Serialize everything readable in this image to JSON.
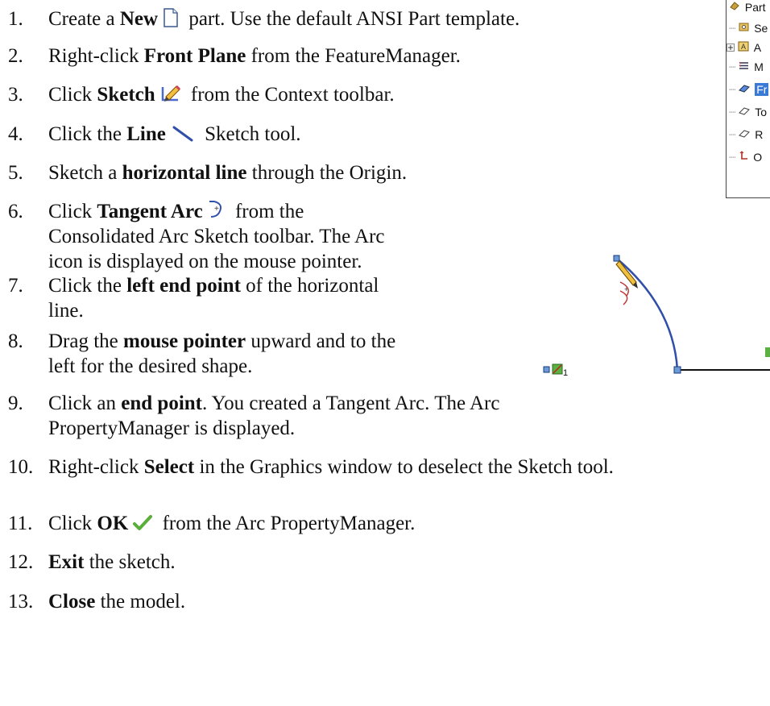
{
  "steps": [
    {
      "num": "1.",
      "segments": [
        {
          "t": "Create a "
        },
        {
          "t": "New",
          "b": true
        },
        {
          "icon": "new-document-icon"
        },
        {
          "t": " part. Use the default ANSI Part template."
        }
      ]
    },
    {
      "num": "2.",
      "segments": [
        {
          "t": "Right-click "
        },
        {
          "t": "Front Plane",
          "b": true
        },
        {
          "t": " from the FeatureManager."
        }
      ]
    },
    {
      "num": "3.",
      "segments": [
        {
          "t": "Click "
        },
        {
          "t": "Sketch",
          "b": true
        },
        {
          "icon": "sketch-icon"
        },
        {
          "t": " from the Context toolbar."
        }
      ]
    },
    {
      "num": "4.",
      "segments": [
        {
          "t": "Click the "
        },
        {
          "t": "Line",
          "b": true
        },
        {
          "icon": "line-icon"
        },
        {
          "t": " Sketch tool."
        }
      ]
    },
    {
      "num": "5.",
      "segments": [
        {
          "t": "Sketch a "
        },
        {
          "t": "horizontal line",
          "b": true
        },
        {
          "t": " through the Origin."
        }
      ]
    },
    {
      "num": "6.",
      "lines": [
        [
          {
            "t": "Click "
          },
          {
            "t": "Tangent Arc",
            "b": true
          },
          {
            "icon": "tangent-arc-icon"
          },
          {
            "t": " from the"
          }
        ],
        [
          {
            "t": "Consolidated Arc Sketch toolbar. The Arc"
          }
        ],
        [
          {
            "t": "icon is displayed on the mouse pointer."
          }
        ]
      ]
    },
    {
      "num": "7.",
      "lines": [
        [
          {
            "t": "Click the "
          },
          {
            "t": "left end point",
            "b": true
          },
          {
            "t": " of the horizontal"
          }
        ],
        [
          {
            "t": "line."
          }
        ]
      ]
    },
    {
      "num": "8.",
      "lines": [
        [
          {
            "t": "Drag the "
          },
          {
            "t": "mouse pointer",
            "b": true
          },
          {
            "t": " upward and to the"
          }
        ],
        [
          {
            "t": "left for the desired shape."
          }
        ]
      ]
    },
    {
      "num": "9.",
      "lines": [
        [
          {
            "t": "Click an "
          },
          {
            "t": "end point",
            "b": true
          },
          {
            "t": ". You created a Tangent Arc. The Arc"
          }
        ],
        [
          {
            "t": "PropertyManager is displayed."
          }
        ]
      ]
    },
    {
      "num": "10.",
      "segments": [
        {
          "t": "Right-click "
        },
        {
          "t": "Select",
          "b": true
        },
        {
          "t": " in the Graphics window to deselect the Sketch tool."
        }
      ]
    },
    {
      "num": "11.",
      "segments": [
        {
          "t": "Click "
        },
        {
          "t": "OK",
          "b": true
        },
        {
          "icon": "ok-check-icon"
        },
        {
          "t": " from the Arc PropertyManager."
        }
      ]
    },
    {
      "num": "12.",
      "segments": [
        {
          "t": "Exit",
          "b": true
        },
        {
          "t": " the sketch."
        }
      ]
    },
    {
      "num": "13.",
      "segments": [
        {
          "t": "Close",
          "b": true
        },
        {
          "t": " the model."
        }
      ]
    }
  ],
  "tree": {
    "items": [
      {
        "label": "Part",
        "icon": "part-icon"
      },
      {
        "label": "Se",
        "icon": "sensors-icon"
      },
      {
        "label": "A",
        "icon": "annotations-icon"
      },
      {
        "label": "M",
        "icon": "material-icon"
      },
      {
        "label": "Fr",
        "icon": "plane-icon",
        "selected": true
      },
      {
        "label": "To",
        "icon": "plane-icon"
      },
      {
        "label": "R",
        "icon": "plane-icon"
      },
      {
        "label": "O",
        "icon": "origin-icon"
      }
    ]
  },
  "graphics": {
    "origin_label": "1"
  },
  "colors": {
    "arc": "#2f4fa8",
    "selection": "#3a7ad6",
    "ok_green": "#5aae3a"
  }
}
